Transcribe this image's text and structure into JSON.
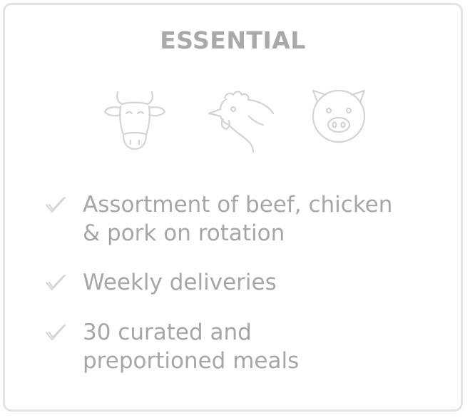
{
  "plan": {
    "title": "ESSENTIAL",
    "icons": [
      "cow-icon",
      "chicken-icon",
      "pig-icon"
    ],
    "features": [
      {
        "line1": "Assortment of beef, chicken",
        "line2": "& pork on rotation"
      },
      {
        "line1": "Weekly deliveries",
        "line2": ""
      },
      {
        "line1": "30 curated and",
        "line2": "preportioned meals"
      }
    ]
  },
  "colors": {
    "text": "#a6a6a6",
    "icon_stroke": "#d4d4d4",
    "border": "#e3e3e3"
  }
}
